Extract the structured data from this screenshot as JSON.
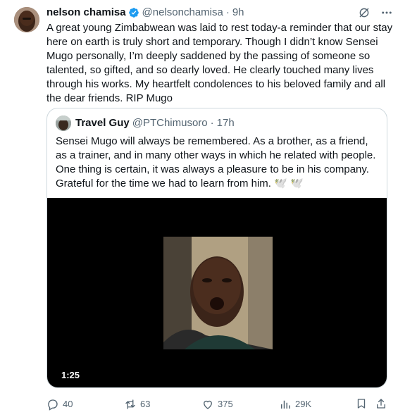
{
  "tweet": {
    "author_name": "nelson chamisa",
    "author_handle": "@nelsonchamisa",
    "separator": "·",
    "time": "9h",
    "text": "A great young  Zimbabwean  was laid to rest today-a reminder that our stay here on earth is truly short  and temporary. Though I didn’t know Sensei Mugo personally, I’m deeply saddened by the passing of someone so talented, so gifted, and so dearly loved. He clearly touched many lives through his works. My heartfelt condolences to his beloved family and all the dear friends. RIP Mugo"
  },
  "quote": {
    "author_name": "Travel Guy",
    "author_handle": "@PTChimusoro",
    "separator": "·",
    "time": "17h",
    "text": "Sensei Mugo will always be remembered. As a brother, as a friend, as a trainer, and in many other ways in which he related with people. One thing is certain, it was always a pleasure to be in his company. Grateful for the time we had to learn from him. 🕊️ 🕊️",
    "video_duration": "1:25"
  },
  "actions": {
    "replies": "40",
    "reposts": "63",
    "likes": "375",
    "views": "29K"
  },
  "colors": {
    "verified": "#1d9bf0",
    "secondary_text": "#536471",
    "border": "#cfd9de"
  },
  "icons": [
    "verified-badge-icon",
    "grok-icon",
    "more-icon",
    "reply-icon",
    "repost-icon",
    "like-icon",
    "views-icon",
    "bookmark-icon",
    "share-icon"
  ]
}
